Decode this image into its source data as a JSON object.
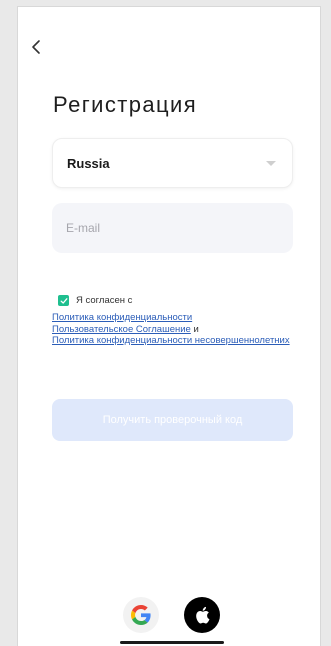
{
  "header": {
    "title": "Регистрация"
  },
  "country_select": {
    "value": "Russia"
  },
  "email": {
    "placeholder": "E-mail",
    "value": ""
  },
  "consent": {
    "checked": true,
    "agree_text": "Я согласен с",
    "privacy_policy": "Политика конфиденциальности",
    "user_agreement": "Пользовательское Соглашение",
    "conjunction": "и",
    "minors_privacy_policy": "Политика конфиденциальности несовершеннолетних"
  },
  "verify_button": {
    "label": "Получить проверочный код"
  },
  "social": {
    "google_icon": "google-icon",
    "apple_icon": "apple-icon"
  },
  "colors": {
    "accent": "#1fbf8f",
    "link": "#2b5db8",
    "button_disabled": "#dfe8fb"
  }
}
